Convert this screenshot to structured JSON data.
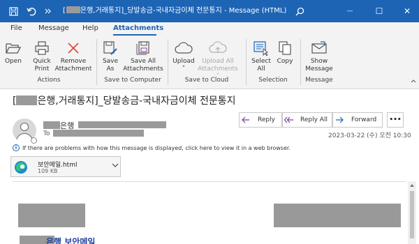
{
  "window": {
    "title_bracket": "[",
    "title_text": "은행,거래통지]_당발송금-국내자금이체 전문통지  -  Message (HTML)",
    "minimize": "—",
    "restore": "☐",
    "close": "✕"
  },
  "tabs": [
    {
      "label": "File"
    },
    {
      "label": "Message"
    },
    {
      "label": "Help"
    },
    {
      "label": "Attachments",
      "active": true
    }
  ],
  "ribbon": {
    "open": "Open",
    "quick_print": [
      "Quick",
      "Print"
    ],
    "remove_attachment": [
      "Remove",
      "Attachment"
    ],
    "save_as": [
      "Save",
      "As"
    ],
    "save_all": [
      "Save All",
      "Attachments"
    ],
    "upload": "Upload",
    "upload_all": [
      "Upload All",
      "Attachments"
    ],
    "select_all": [
      "Select",
      "All"
    ],
    "copy": "Copy",
    "show_message": [
      "Show",
      "Message"
    ],
    "groups": {
      "actions": "Actions",
      "save_to_computer": "Save to Computer",
      "save_to_cloud": "Save to Cloud",
      "selection": "Selection",
      "message": "Message"
    }
  },
  "message": {
    "subject_bracket": "[",
    "subject_text": "은행,거래통지]_당발송금-국내자금이체 전문통지",
    "sender_suffix": "은행",
    "to_label": "To",
    "reply": "Reply",
    "reply_all": "Reply All",
    "forward": "Forward",
    "more": "•••",
    "date": "2023-03-22 (수) 오전 10:30",
    "info_bar": "If there are problems with how this message is displayed, click here to view it in a web browser."
  },
  "attachment": {
    "filename": "보안메일.html",
    "size": "109 KB"
  },
  "body": {
    "heading": "은행 보안메일"
  },
  "colors": {
    "accent": "#1d64b5",
    "reply_purple": "#7a3fa0",
    "forward_blue": "#1d64b5"
  }
}
